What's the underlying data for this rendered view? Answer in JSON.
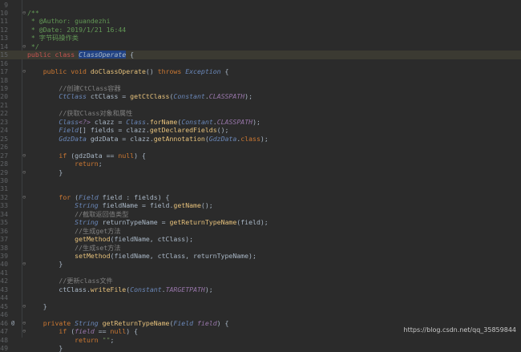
{
  "lines": [
    {
      "num": "9",
      "marker": "",
      "fold": "",
      "tokens": []
    },
    {
      "num": "10",
      "marker": "",
      "fold": "⊖",
      "tokens": [
        {
          "t": "/**",
          "c": "doc"
        }
      ]
    },
    {
      "num": "11",
      "marker": "",
      "fold": "",
      "tokens": [
        {
          "t": " * @Author: guandezhi",
          "c": "doc"
        }
      ]
    },
    {
      "num": "12",
      "marker": "",
      "fold": "",
      "tokens": [
        {
          "t": " * @Date: 2019/1/21 16:44",
          "c": "doc"
        }
      ]
    },
    {
      "num": "13",
      "marker": "",
      "fold": "",
      "tokens": [
        {
          "t": " * 字节码操作类",
          "c": "doc"
        }
      ]
    },
    {
      "num": "14",
      "marker": "",
      "fold": "⊖",
      "tokens": [
        {
          "t": " */",
          "c": "doc"
        }
      ]
    },
    {
      "num": "15",
      "marker": "",
      "fold": "",
      "current": true,
      "tokens": [
        {
          "t": "public class ",
          "c": "kwred"
        },
        {
          "t": "ClassOperate",
          "c": "classsel"
        },
        {
          "t": " {",
          "c": "default"
        }
      ]
    },
    {
      "num": "16",
      "marker": "",
      "fold": "",
      "tokens": []
    },
    {
      "num": "17",
      "marker": "",
      "fold": "⊖",
      "tokens": [
        {
          "t": "    public void ",
          "c": "kw"
        },
        {
          "t": "doClassOperate",
          "c": "method"
        },
        {
          "t": "() ",
          "c": "default"
        },
        {
          "t": "throws ",
          "c": "kw"
        },
        {
          "t": "Exception",
          "c": "type"
        },
        {
          "t": " {",
          "c": "default"
        }
      ]
    },
    {
      "num": "18",
      "marker": "",
      "fold": "",
      "tokens": []
    },
    {
      "num": "19",
      "marker": "",
      "fold": "",
      "tokens": [
        {
          "t": "        //创建CtClass容器",
          "c": "comment"
        }
      ]
    },
    {
      "num": "20",
      "marker": "",
      "fold": "",
      "tokens": [
        {
          "t": "        CtClass ",
          "c": "type"
        },
        {
          "t": "ctClass = ",
          "c": "default"
        },
        {
          "t": "getCtClass",
          "c": "method"
        },
        {
          "t": "(",
          "c": "default"
        },
        {
          "t": "Constant",
          "c": "type"
        },
        {
          "t": ".",
          "c": "default"
        },
        {
          "t": "CLASSPATH",
          "c": "field"
        },
        {
          "t": ");",
          "c": "default"
        }
      ]
    },
    {
      "num": "21",
      "marker": "",
      "fold": "",
      "tokens": []
    },
    {
      "num": "22",
      "marker": "",
      "fold": "",
      "tokens": [
        {
          "t": "        //获取Class对象和属性",
          "c": "comment"
        }
      ]
    },
    {
      "num": "23",
      "marker": "",
      "fold": "",
      "tokens": [
        {
          "t": "        Class",
          "c": "type"
        },
        {
          "t": "<?>",
          "c": "field"
        },
        {
          "t": " clazz = ",
          "c": "default"
        },
        {
          "t": "Class",
          "c": "type"
        },
        {
          "t": ".",
          "c": "default"
        },
        {
          "t": "forName",
          "c": "method"
        },
        {
          "t": "(",
          "c": "default"
        },
        {
          "t": "Constant",
          "c": "type"
        },
        {
          "t": ".",
          "c": "default"
        },
        {
          "t": "CLASSPATH",
          "c": "field"
        },
        {
          "t": ");",
          "c": "default"
        }
      ]
    },
    {
      "num": "24",
      "marker": "",
      "fold": "",
      "tokens": [
        {
          "t": "        Field",
          "c": "type"
        },
        {
          "t": "[] fields = clazz.",
          "c": "default"
        },
        {
          "t": "getDeclaredFields",
          "c": "method"
        },
        {
          "t": "();",
          "c": "default"
        }
      ]
    },
    {
      "num": "25",
      "marker": "",
      "fold": "",
      "tokens": [
        {
          "t": "        GdzData ",
          "c": "type"
        },
        {
          "t": "gdzData = clazz.",
          "c": "default"
        },
        {
          "t": "getAnnotation",
          "c": "method"
        },
        {
          "t": "(",
          "c": "default"
        },
        {
          "t": "GdzData",
          "c": "type"
        },
        {
          "t": ".",
          "c": "default"
        },
        {
          "t": "class",
          "c": "kw"
        },
        {
          "t": ");",
          "c": "default"
        }
      ]
    },
    {
      "num": "26",
      "marker": "",
      "fold": "",
      "tokens": []
    },
    {
      "num": "27",
      "marker": "",
      "fold": "⊖",
      "tokens": [
        {
          "t": "        if ",
          "c": "kw"
        },
        {
          "t": "(gdzData == ",
          "c": "default"
        },
        {
          "t": "null",
          "c": "kw"
        },
        {
          "t": ") {",
          "c": "default"
        }
      ]
    },
    {
      "num": "28",
      "marker": "",
      "fold": "",
      "tokens": [
        {
          "t": "            return",
          "c": "kw"
        },
        {
          "t": ";",
          "c": "default"
        }
      ]
    },
    {
      "num": "29",
      "marker": "",
      "fold": "⊖",
      "tokens": [
        {
          "t": "        }",
          "c": "default"
        }
      ]
    },
    {
      "num": "30",
      "marker": "",
      "fold": "",
      "tokens": []
    },
    {
      "num": "31",
      "marker": "",
      "fold": "",
      "tokens": []
    },
    {
      "num": "32",
      "marker": "",
      "fold": "⊖",
      "tokens": [
        {
          "t": "        for ",
          "c": "kw"
        },
        {
          "t": "(",
          "c": "default"
        },
        {
          "t": "Field",
          "c": "type"
        },
        {
          "t": " field : fields) {",
          "c": "default"
        }
      ]
    },
    {
      "num": "33",
      "marker": "",
      "fold": "",
      "tokens": [
        {
          "t": "            String ",
          "c": "type"
        },
        {
          "t": "fieldName = field.",
          "c": "default"
        },
        {
          "t": "getName",
          "c": "method"
        },
        {
          "t": "();",
          "c": "default"
        }
      ]
    },
    {
      "num": "34",
      "marker": "",
      "fold": "",
      "tokens": [
        {
          "t": "            //截取返回值类型",
          "c": "comment"
        }
      ]
    },
    {
      "num": "35",
      "marker": "",
      "fold": "",
      "tokens": [
        {
          "t": "            String ",
          "c": "type"
        },
        {
          "t": "returnTypeName = ",
          "c": "default"
        },
        {
          "t": "getReturnTypeName",
          "c": "method"
        },
        {
          "t": "(field);",
          "c": "default"
        }
      ]
    },
    {
      "num": "36",
      "marker": "",
      "fold": "",
      "tokens": [
        {
          "t": "            //生成get方法",
          "c": "comment"
        }
      ]
    },
    {
      "num": "37",
      "marker": "",
      "fold": "",
      "tokens": [
        {
          "t": "            getMethod",
          "c": "method"
        },
        {
          "t": "(fieldName, ctClass);",
          "c": "default"
        }
      ]
    },
    {
      "num": "38",
      "marker": "",
      "fold": "",
      "tokens": [
        {
          "t": "            //生成set方法",
          "c": "comment"
        }
      ]
    },
    {
      "num": "39",
      "marker": "",
      "fold": "",
      "tokens": [
        {
          "t": "            setMethod",
          "c": "method"
        },
        {
          "t": "(fieldName, ctClass, returnTypeName);",
          "c": "default"
        }
      ]
    },
    {
      "num": "40",
      "marker": "",
      "fold": "⊖",
      "tokens": [
        {
          "t": "        }",
          "c": "default"
        }
      ]
    },
    {
      "num": "41",
      "marker": "",
      "fold": "",
      "tokens": []
    },
    {
      "num": "42",
      "marker": "",
      "fold": "",
      "tokens": [
        {
          "t": "        //更新class文件",
          "c": "comment"
        }
      ]
    },
    {
      "num": "43",
      "marker": "",
      "fold": "",
      "tokens": [
        {
          "t": "        ctClass.",
          "c": "default"
        },
        {
          "t": "writeFile",
          "c": "method"
        },
        {
          "t": "(",
          "c": "default"
        },
        {
          "t": "Constant",
          "c": "type"
        },
        {
          "t": ".",
          "c": "default"
        },
        {
          "t": "TARGETPATH",
          "c": "field"
        },
        {
          "t": ");",
          "c": "default"
        }
      ]
    },
    {
      "num": "44",
      "marker": "",
      "fold": "",
      "tokens": []
    },
    {
      "num": "45",
      "marker": "",
      "fold": "⊖",
      "tokens": [
        {
          "t": "    }",
          "c": "default"
        }
      ]
    },
    {
      "num": "46",
      "marker": "",
      "fold": "",
      "tokens": []
    },
    {
      "num": "46",
      "marker": "@",
      "fold": "⊖",
      "tokens": [
        {
          "t": "    private ",
          "c": "kw"
        },
        {
          "t": "String ",
          "c": "type"
        },
        {
          "t": "getReturnTypeName",
          "c": "method"
        },
        {
          "t": "(",
          "c": "default"
        },
        {
          "t": "Field ",
          "c": "type"
        },
        {
          "t": "field",
          "c": "field"
        },
        {
          "t": ") {",
          "c": "default"
        }
      ]
    },
    {
      "num": "47",
      "marker": "",
      "fold": "⊖",
      "tokens": [
        {
          "t": "        if ",
          "c": "kw"
        },
        {
          "t": "(",
          "c": "default"
        },
        {
          "t": "field",
          "c": "field"
        },
        {
          "t": " == ",
          "c": "default"
        },
        {
          "t": "null",
          "c": "kw"
        },
        {
          "t": ") {",
          "c": "default"
        }
      ]
    },
    {
      "num": "48",
      "marker": "",
      "fold": "",
      "tokens": [
        {
          "t": "            return ",
          "c": "kw"
        },
        {
          "t": "\"\"",
          "c": "string"
        },
        {
          "t": ";",
          "c": "default"
        }
      ]
    },
    {
      "num": "49",
      "marker": "",
      "fold": "",
      "tokens": [
        {
          "t": "        }",
          "c": "default"
        }
      ]
    }
  ],
  "watermark": "https://blog.csdn.net/qq_35859844"
}
